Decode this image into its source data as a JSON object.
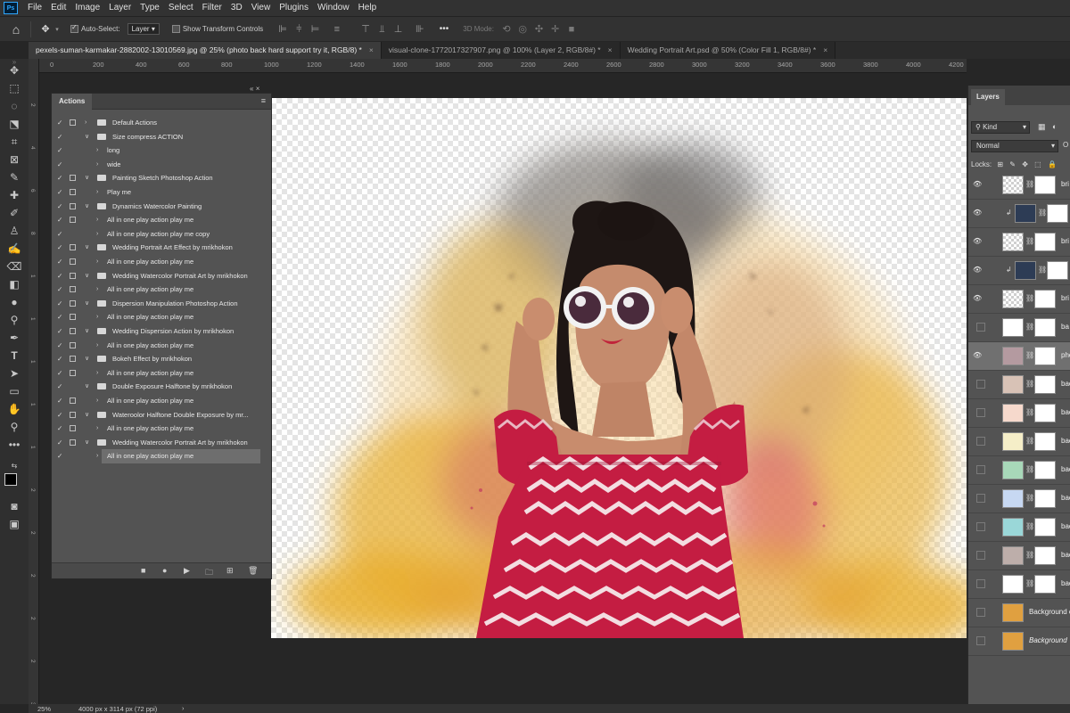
{
  "app": {
    "logo": "Ps"
  },
  "menu": [
    "File",
    "Edit",
    "Image",
    "Layer",
    "Type",
    "Select",
    "Filter",
    "3D",
    "View",
    "Plugins",
    "Window",
    "Help"
  ],
  "options": {
    "auto_select_label": "Auto-Select:",
    "auto_select_value": "Layer",
    "transform_label": "Show Transform Controls",
    "mode_label": "3D Mode:",
    "more": "•••"
  },
  "tabs": [
    {
      "label": "pexels-suman-karmakar-2882002-13010569.jpg @ 25% (photo back hard support try it, RGB/8) *",
      "close": "×"
    },
    {
      "label": "visual-clone-1772017327907.png @ 100% (Layer 2, RGB/8#) *",
      "close": "×"
    },
    {
      "label": "Wedding Portrait Art.psd @ 50% (Color Fill 1, RGB/8#) *",
      "close": "×"
    }
  ],
  "ruler_top": [
    "0",
    "200",
    "400",
    "600",
    "800",
    "1000",
    "1200",
    "1400",
    "1600",
    "1800",
    "2000",
    "2200",
    "2400",
    "2600",
    "2800",
    "3000",
    "3200",
    "3400",
    "3600",
    "3800",
    "4000",
    "4200"
  ],
  "ruler_left": [
    "2",
    "4",
    "6",
    "8",
    "1",
    "1",
    "1",
    "1",
    "1",
    "2",
    "2",
    "2",
    "2",
    "2",
    "3"
  ],
  "actions_panel": {
    "title": "Actions",
    "collapse": "«",
    "close": "×",
    "menu": "≡",
    "items": [
      {
        "label": "Default Actions",
        "type": "set",
        "checked": true,
        "dialog": true
      },
      {
        "label": "Size compress ACTION",
        "type": "set",
        "checked": true,
        "dialog": false,
        "open": true
      },
      {
        "label": "long",
        "type": "action",
        "checked": true,
        "dialog": false
      },
      {
        "label": "wide",
        "type": "action",
        "checked": true,
        "dialog": false
      },
      {
        "label": "Painting Sketch Photoshop Action",
        "type": "set",
        "checked": true,
        "dialog": true,
        "open": true
      },
      {
        "label": "Play me",
        "type": "action",
        "checked": true,
        "dialog": true
      },
      {
        "label": "Dynamics Watercolor Painting",
        "type": "set",
        "checked": true,
        "dialog": true,
        "open": true
      },
      {
        "label": "All in one play action play me",
        "type": "action",
        "checked": true,
        "dialog": true
      },
      {
        "label": "All in one play action play me  copy",
        "type": "action",
        "checked": true,
        "dialog": false
      },
      {
        "label": "Wedding Portrait Art Effect by mrikhokon",
        "type": "set",
        "checked": true,
        "dialog": true,
        "open": true
      },
      {
        "label": "All in one play action play me",
        "type": "action",
        "checked": true,
        "dialog": true
      },
      {
        "label": "Wedding Watercolor Portrait Art by mrikhokon",
        "type": "set",
        "checked": true,
        "dialog": true,
        "open": true
      },
      {
        "label": "All in one play action play me",
        "type": "action",
        "checked": true,
        "dialog": true
      },
      {
        "label": "Dispersion Manipulation Photoshop Action",
        "type": "set",
        "checked": true,
        "dialog": true,
        "open": true
      },
      {
        "label": "All in one play action play me",
        "type": "action",
        "checked": true,
        "dialog": true
      },
      {
        "label": "Wedding Dispersion Action by mrikhokon",
        "type": "set",
        "checked": true,
        "dialog": true,
        "open": true
      },
      {
        "label": "All in one play action play me",
        "type": "action",
        "checked": true,
        "dialog": true
      },
      {
        "label": "Bokeh Effect by mrikhokon",
        "type": "set",
        "checked": true,
        "dialog": true,
        "open": true
      },
      {
        "label": "All in one play action play me",
        "type": "action",
        "checked": true,
        "dialog": true
      },
      {
        "label": "Double Exposure Halftone by mrikhokon",
        "type": "set",
        "checked": true,
        "dialog": false,
        "open": true
      },
      {
        "label": "All in one play action play me",
        "type": "action",
        "checked": true,
        "dialog": true
      },
      {
        "label": "Wateroolor Halftone Double Exposure by mr...",
        "type": "set",
        "checked": true,
        "dialog": true,
        "open": true
      },
      {
        "label": "All in one play action play me",
        "type": "action",
        "checked": true,
        "dialog": true
      },
      {
        "label": "Wedding Watercolor Portrait Art by mrikhokon",
        "type": "set",
        "checked": true,
        "dialog": true,
        "open": true
      },
      {
        "label": "All in one play action play me",
        "type": "action",
        "checked": true,
        "dialog": false,
        "selected": true
      }
    ],
    "footer": [
      "■",
      "●",
      "▶",
      "🗀",
      "⊞",
      "🗑"
    ]
  },
  "layers_panel": {
    "title": "Layers",
    "filter_kind": "Kind",
    "blend_mode": "Normal",
    "opacity_label": "O",
    "locks_label": "Locks:",
    "layers": [
      {
        "name": "bri",
        "visible": true,
        "thumb": "checker",
        "mask": true
      },
      {
        "name": "",
        "visible": true,
        "thumb": "#2d3c55",
        "mask": true,
        "clipped": true
      },
      {
        "name": "bri",
        "visible": true,
        "thumb": "checker",
        "mask": true
      },
      {
        "name": "",
        "visible": true,
        "thumb": "#2d3c55",
        "mask": true,
        "clipped": true
      },
      {
        "name": "bri",
        "visible": true,
        "thumb": "checker",
        "mask": true
      },
      {
        "name": "ba",
        "visible": false,
        "thumb": "#ffffff",
        "mask": true
      },
      {
        "name": "photo",
        "visible": true,
        "thumb": "#b49aa0",
        "mask": true,
        "active": true
      },
      {
        "name": "backg",
        "visible": false,
        "thumb": "#d8c2b6",
        "mask": true
      },
      {
        "name": "backg",
        "visible": false,
        "thumb": "#f6d9cc",
        "mask": true
      },
      {
        "name": "backg",
        "visible": false,
        "thumb": "#f5eec8",
        "mask": true
      },
      {
        "name": "backg",
        "visible": false,
        "thumb": "#a8d8b9",
        "mask": true
      },
      {
        "name": "backg",
        "visible": false,
        "thumb": "#c7d8f2",
        "mask": true
      },
      {
        "name": "backg",
        "visible": false,
        "thumb": "#9ad7d8",
        "mask": true
      },
      {
        "name": "backg",
        "visible": false,
        "thumb": "#bdaeaa",
        "mask": true
      },
      {
        "name": "backg",
        "visible": false,
        "thumb": "#ffffff",
        "mask": true
      },
      {
        "name": "Background cop",
        "visible": false,
        "thumb": "#e0a040",
        "mask": false
      },
      {
        "name": "Background",
        "visible": false,
        "thumb": "#e0a040",
        "mask": false,
        "italic": true
      }
    ]
  },
  "status": {
    "zoom": "25%",
    "doc_info": "4000 px x 3114 px (72 ppi)",
    "arrow": "›"
  },
  "colors": {
    "accent": "#31a8ff",
    "panel": "#535353",
    "chrome": "#323232"
  }
}
